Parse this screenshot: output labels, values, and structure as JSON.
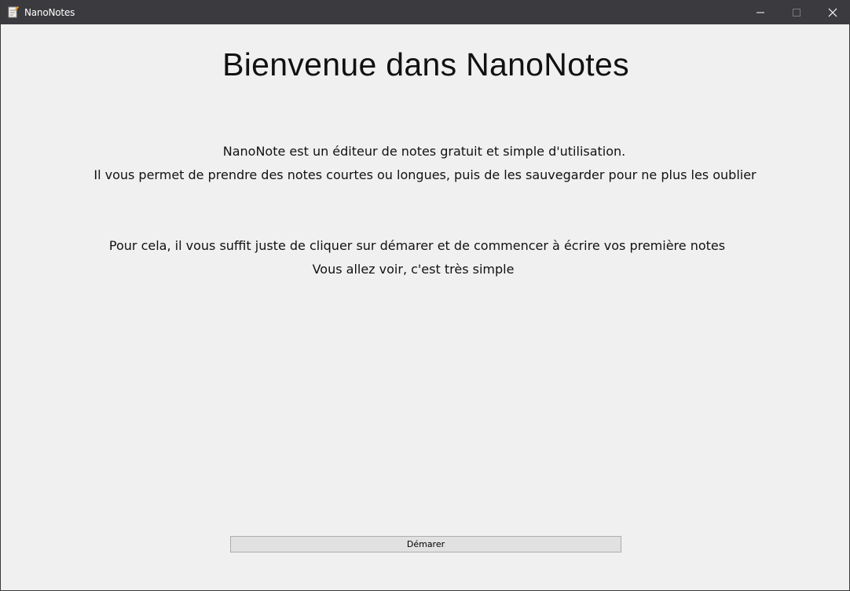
{
  "window": {
    "title": "NanoNotes",
    "controls": {
      "minimize": "minimize-icon",
      "maximize": "maximize-icon",
      "close": "close-icon"
    }
  },
  "main": {
    "heading": "Bienvenue dans NanoNotes",
    "intro_line_1": "NanoNote est un éditeur de notes gratuit et simple d'utilisation.",
    "intro_line_2": "Il vous permet de prendre des notes courtes ou longues, puis de les sauvegarder pour ne plus les oublier",
    "howto_line_1": "Pour cela, il vous suffit juste de cliquer sur démarer et de commencer à écrire vos première notes",
    "howto_line_2": "Vous allez voir, c'est très simple",
    "start_button_label": "Démarer"
  },
  "colors": {
    "titlebar_bg": "#3b3a3e",
    "window_bg": "#f0f0f0",
    "button_bg": "#e1e1e1",
    "button_border": "#adadad"
  }
}
